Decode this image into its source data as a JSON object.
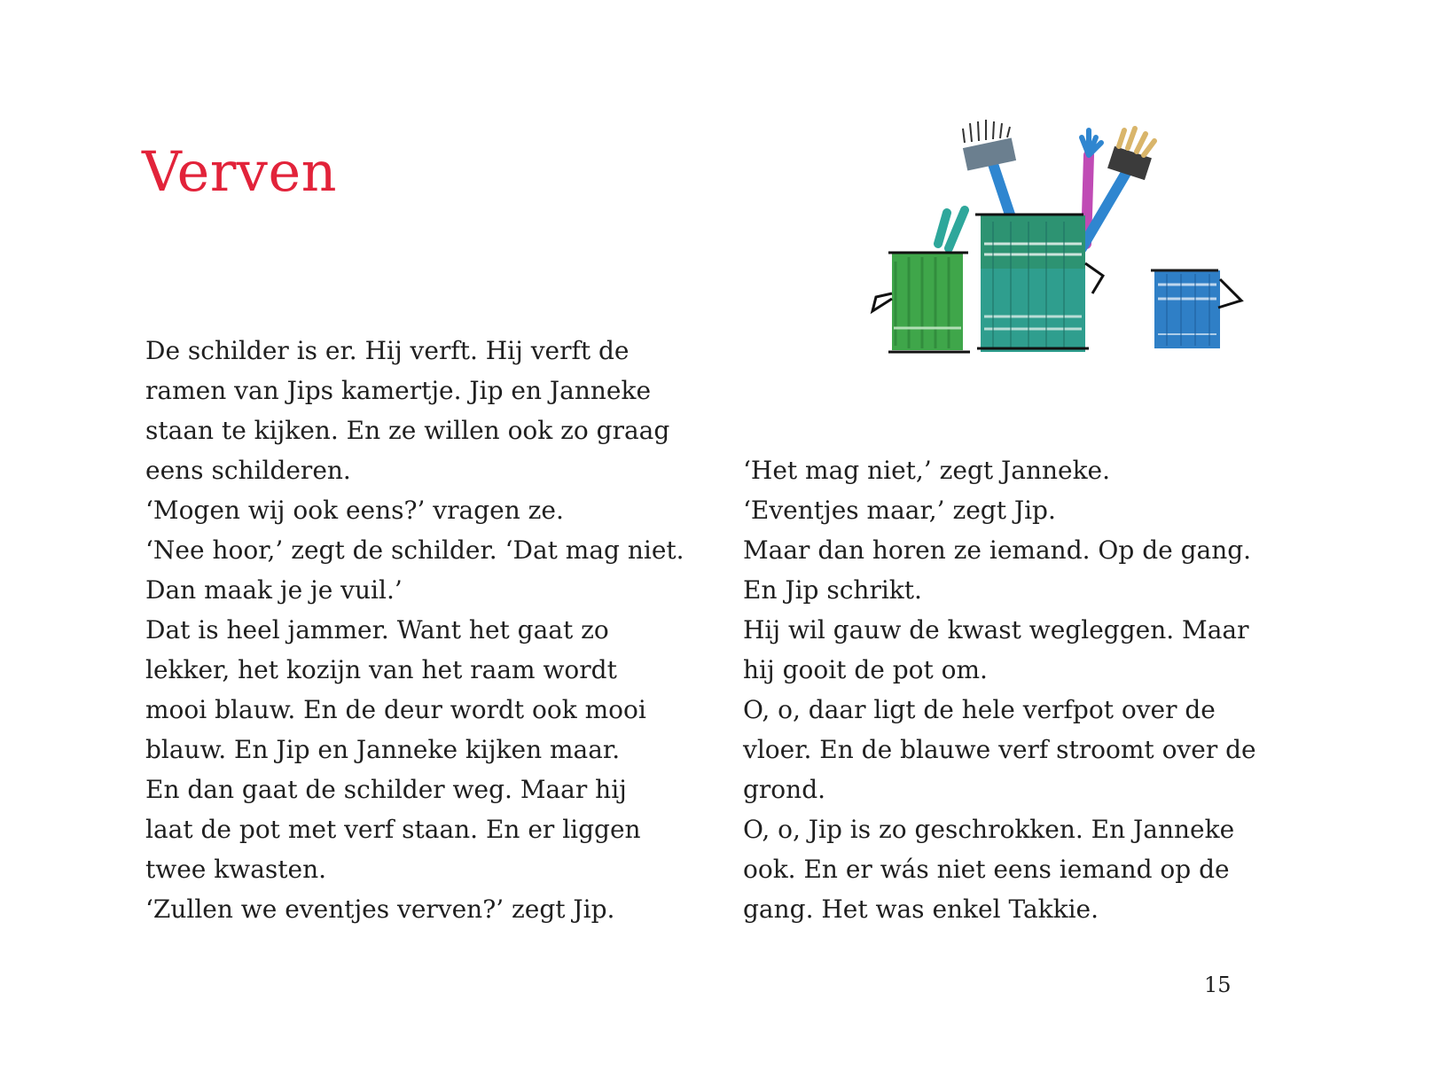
{
  "page": {
    "title": "Verven",
    "page_number": "15"
  },
  "left_column": {
    "lines": [
      "De schilder is er. Hij verft. Hij verft de",
      "ramen van Jips kamertje. Jip en Janneke",
      "staan te kijken. En ze willen ook zo graag",
      "eens schilderen.",
      "‘Mogen wij ook eens?’ vragen ze.",
      "‘Nee hoor,’ zegt de schilder. ‘Dat mag niet.",
      "Dan maak je je vuil.’",
      "Dat is heel jammer. Want het gaat zo",
      "lekker, het kozijn van het raam wordt",
      "mooi blauw. En de deur wordt ook mooi",
      "blauw. En Jip en Janneke kijken maar.",
      "En dan gaat de schilder weg. Maar hij",
      "laat de pot met verf staan. En er liggen",
      "twee kwasten.",
      "‘Zullen we eventjes verven?’ zegt Jip."
    ]
  },
  "right_column": {
    "lines": [
      "‘Het mag niet,’ zegt Janneke.",
      "‘Eventjes maar,’ zegt Jip.",
      "Maar dan horen ze iemand. Op de gang.",
      "En Jip schrikt.",
      "Hij wil gauw de kwast wegleggen. Maar",
      "hij gooit de pot om.",
      "O, o, daar ligt de hele verfpot over de",
      "vloer. En de blauwe verf stroomt over de",
      "grond.",
      "O, o, Jip is zo geschrokken. En Janneke",
      "ook. En er wás niet eens iemand op de",
      "gang. Het was enkel Takkie."
    ]
  },
  "colors": {
    "title": "#e2233a",
    "text": "#1f1f1f",
    "pot_green": "#3fa64a",
    "pot_teal": "#2f9e8e",
    "pot_blue": "#2f7fc6",
    "brush_pink": "#c04bb5",
    "brush_blue": "#2f86d0",
    "bristles_tan": "#d9b56a"
  },
  "illustration": {
    "subject": "paint-pots-with-brushes-illustration"
  }
}
